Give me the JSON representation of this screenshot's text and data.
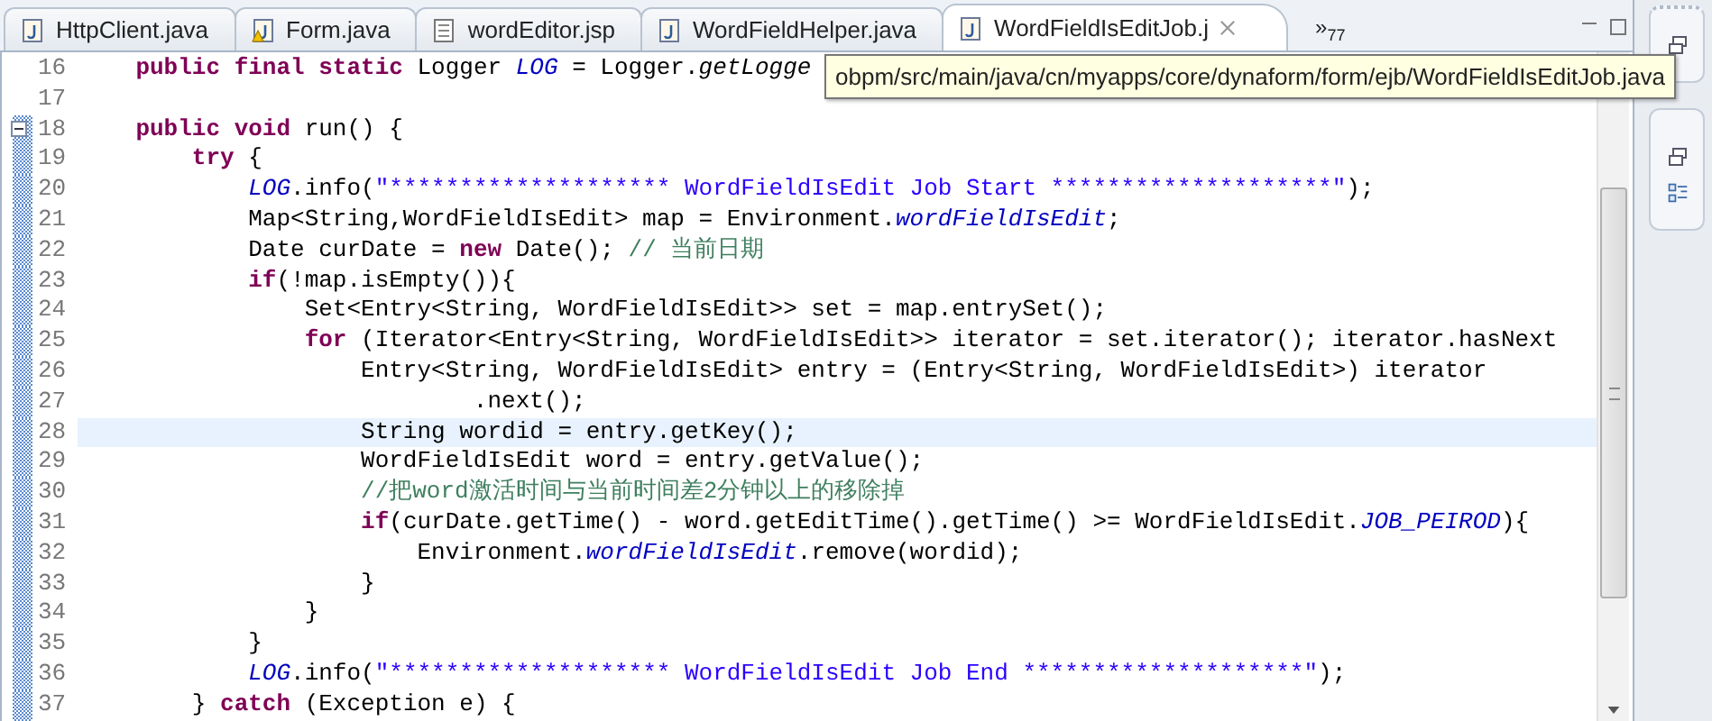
{
  "tabs": [
    {
      "label": "HttpClient.java",
      "kind": "java",
      "selected": false
    },
    {
      "label": "Form.java",
      "kind": "java-warning",
      "selected": false
    },
    {
      "label": "wordEditor.jsp",
      "kind": "jsp",
      "selected": false
    },
    {
      "label": "WordFieldHelper.java",
      "kind": "java",
      "selected": false
    },
    {
      "label": "WordFieldIsEditJob.j",
      "kind": "java",
      "selected": true
    }
  ],
  "overflow": {
    "symbol": "»",
    "count": "77"
  },
  "tooltip": "obpm/src/main/java/cn/myapps/core/dynaform/form/ejb/WordFieldIsEditJob.java",
  "lines": [
    {
      "number": "16",
      "current": false,
      "in_range": false,
      "segments": [
        {
          "kind": "kw",
          "t": "    public"
        },
        {
          "kind": "kw",
          "t": " final"
        },
        {
          "kind": "kw",
          "t": " static"
        },
        {
          "kind": "plain",
          "t": " Logger "
        },
        {
          "kind": "field",
          "t": "LOG"
        },
        {
          "kind": "plain",
          "t": " = Logger."
        },
        {
          "kind": "smethod",
          "t": "getLogge"
        }
      ]
    },
    {
      "number": "17",
      "current": false,
      "in_range": false
    },
    {
      "number": "18",
      "current": false,
      "in_range": true,
      "expanded": true,
      "segments": [
        {
          "kind": "kw",
          "t": "    public"
        },
        {
          "kind": "kw",
          "t": " void"
        },
        {
          "kind": "plain",
          "t": " run() {"
        }
      ]
    },
    {
      "number": "19",
      "current": false,
      "in_range": true,
      "segments": [
        {
          "kind": "kw",
          "t": "        try"
        },
        {
          "kind": "plain",
          "t": " {"
        }
      ]
    },
    {
      "number": "20",
      "current": false,
      "in_range": true,
      "segments": [
        {
          "kind": "field",
          "t": "            LOG"
        },
        {
          "kind": "plain",
          "t": ".info("
        },
        {
          "kind": "str",
          "t": "\"******************** WordFieldIsEdit Job Start ********************\""
        },
        {
          "kind": "plain",
          "t": ");"
        }
      ]
    },
    {
      "number": "21",
      "current": false,
      "in_range": true,
      "segments": [
        {
          "kind": "plain",
          "t": "            Map<String,WordFieldIsEdit> map = Environment."
        },
        {
          "kind": "field",
          "t": "wordFieldIsEdit"
        },
        {
          "kind": "plain",
          "t": ";"
        }
      ]
    },
    {
      "number": "22",
      "current": false,
      "in_range": true,
      "segments": [
        {
          "kind": "plain",
          "t": "            Date curDate = "
        },
        {
          "kind": "kw",
          "t": "new"
        },
        {
          "kind": "plain",
          "t": " Date(); "
        },
        {
          "kind": "comment",
          "t": "// 当前日期"
        }
      ]
    },
    {
      "number": "23",
      "current": false,
      "in_range": true,
      "segments": [
        {
          "kind": "kw",
          "t": "            if"
        },
        {
          "kind": "plain",
          "t": "(!map.isEmpty()){"
        }
      ]
    },
    {
      "number": "24",
      "current": false,
      "in_range": true,
      "segments": [
        {
          "kind": "plain",
          "t": "                Set<Entry<String, WordFieldIsEdit>> set = map.entrySet();"
        }
      ]
    },
    {
      "number": "25",
      "current": false,
      "in_range": true,
      "segments": [
        {
          "kind": "kw",
          "t": "                for"
        },
        {
          "kind": "plain",
          "t": " (Iterator<Entry<String, WordFieldIsEdit>> iterator = set.iterator(); iterator.hasNext"
        }
      ]
    },
    {
      "number": "26",
      "current": false,
      "in_range": true,
      "segments": [
        {
          "kind": "plain",
          "t": "                    Entry<String, WordFieldIsEdit> entry = (Entry<String, WordFieldIsEdit>) iterator"
        }
      ]
    },
    {
      "number": "27",
      "current": false,
      "in_range": true,
      "segments": [
        {
          "kind": "plain",
          "t": "                            .next();"
        }
      ]
    },
    {
      "number": "28",
      "current": true,
      "in_range": true,
      "segments": [
        {
          "kind": "plain",
          "t": "                    String wordid = entry.getKey();"
        }
      ]
    },
    {
      "number": "29",
      "current": false,
      "in_range": true,
      "segments": [
        {
          "kind": "plain",
          "t": "                    WordFieldIsEdit word = entry.getValue();"
        }
      ]
    },
    {
      "number": "30",
      "current": false,
      "in_range": true,
      "segments": [
        {
          "kind": "comment",
          "t": "                    //把word激活时间与当前时间差2分钟以上的移除掉"
        }
      ]
    },
    {
      "number": "31",
      "current": false,
      "in_range": true,
      "segments": [
        {
          "kind": "kw",
          "t": "                    if"
        },
        {
          "kind": "plain",
          "t": "(curDate.getTime() - word.getEditTime().getTime() >= WordFieldIsEdit."
        },
        {
          "kind": "field",
          "t": "JOB_PEIROD"
        },
        {
          "kind": "plain",
          "t": "){"
        }
      ]
    },
    {
      "number": "32",
      "current": false,
      "in_range": true,
      "segments": [
        {
          "kind": "plain",
          "t": "                        Environment."
        },
        {
          "kind": "field",
          "t": "wordFieldIsEdit"
        },
        {
          "kind": "plain",
          "t": ".remove(wordid);"
        }
      ]
    },
    {
      "number": "33",
      "current": false,
      "in_range": true,
      "segments": [
        {
          "kind": "plain",
          "t": "                    }"
        }
      ]
    },
    {
      "number": "34",
      "current": false,
      "in_range": true,
      "segments": [
        {
          "kind": "plain",
          "t": "                }"
        }
      ]
    },
    {
      "number": "35",
      "current": false,
      "in_range": true,
      "segments": [
        {
          "kind": "plain",
          "t": "            }"
        }
      ]
    },
    {
      "number": "36",
      "current": false,
      "in_range": true,
      "segments": [
        {
          "kind": "field",
          "t": "            LOG"
        },
        {
          "kind": "plain",
          "t": ".info("
        },
        {
          "kind": "str",
          "t": "\"******************** WordFieldIsEdit Job End ********************\""
        },
        {
          "kind": "plain",
          "t": ");"
        }
      ]
    },
    {
      "number": "37",
      "current": false,
      "in_range": true,
      "segments": [
        {
          "kind": "plain",
          "t": "        } "
        },
        {
          "kind": "kw",
          "t": "catch"
        },
        {
          "kind": "plain",
          "t": " (Exception e) {"
        }
      ]
    }
  ]
}
